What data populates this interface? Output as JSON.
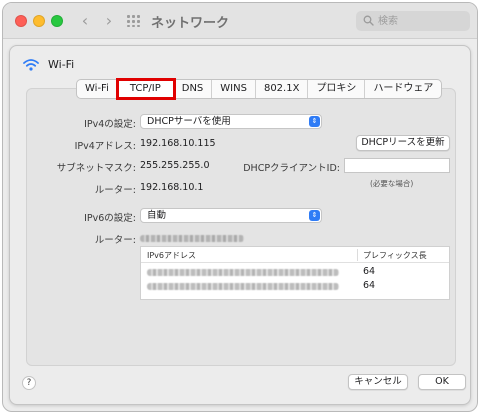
{
  "window": {
    "title": "ネットワーク",
    "search_placeholder": "検索"
  },
  "sheet": {
    "interface_name": "Wi-Fi",
    "tabs": [
      {
        "label": "Wi-Fi"
      },
      {
        "label": "TCP/IP"
      },
      {
        "label": "DNS"
      },
      {
        "label": "WINS"
      },
      {
        "label": "802.1X"
      },
      {
        "label": "プロキシ"
      },
      {
        "label": "ハードウェア"
      }
    ],
    "selected_tab": "TCP/IP",
    "ipv4": {
      "config_label": "IPv4の設定:",
      "config_value": "DHCPサーバを使用",
      "address_label": "IPv4アドレス:",
      "address_value": "192.168.10.115",
      "subnet_label": "サブネットマスク:",
      "subnet_value": "255.255.255.0",
      "router_label": "ルーター:",
      "router_value": "192.168.10.1",
      "renew_button": "DHCPリースを更新",
      "client_id_label": "DHCPクライアントID:",
      "client_id_value": "",
      "client_id_note": "(必要な場合)"
    },
    "ipv6": {
      "config_label": "IPv6の設定:",
      "config_value": "自動",
      "router_label": "ルーター:",
      "table_headers": {
        "address": "IPv6アドレス",
        "prefix": "プレフィックス長"
      },
      "rows": [
        {
          "prefix": "64"
        },
        {
          "prefix": "64"
        }
      ]
    },
    "buttons": {
      "help": "?",
      "cancel": "キャンセル",
      "ok": "OK"
    }
  },
  "colors": {
    "accent": "#2f7cf6",
    "highlight_box": "#e00000",
    "close": "#fe5f57",
    "minimize": "#febc2e",
    "zoom": "#28c840"
  }
}
